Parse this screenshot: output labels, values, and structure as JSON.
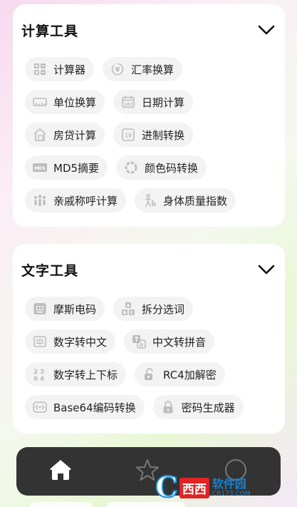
{
  "sections": [
    {
      "title": "计算工具",
      "rows": [
        [
          {
            "label": "计算器",
            "icon": "calculator-icon"
          },
          {
            "label": "汇率换算",
            "icon": "currency-exchange-icon"
          }
        ],
        [
          {
            "label": "单位换算",
            "icon": "ruler-icon"
          },
          {
            "label": "日期计算",
            "icon": "calendar-icon"
          }
        ],
        [
          {
            "label": "房贷计算",
            "icon": "house-loan-icon"
          },
          {
            "label": "进制转换",
            "icon": "number-base-icon"
          }
        ],
        [
          {
            "label": "MD5摘要",
            "icon": "md5-icon"
          },
          {
            "label": "颜色码转换",
            "icon": "color-wheel-icon"
          }
        ],
        [
          {
            "label": "亲戚称呼计算",
            "icon": "family-icon"
          },
          {
            "label": "身体质量指数",
            "icon": "body-mass-icon"
          }
        ]
      ]
    },
    {
      "title": "文字工具",
      "rows": [
        [
          {
            "label": "摩斯电码",
            "icon": "keypad-icon"
          },
          {
            "label": "拆分选词",
            "icon": "split-words-icon"
          }
        ],
        [
          {
            "label": "数字转中文",
            "icon": "number-to-chinese-icon"
          },
          {
            "label": "中文转拼音",
            "icon": "chinese-to-pinyin-icon"
          }
        ],
        [
          {
            "label": "数字转上下标",
            "icon": "superscript-icon"
          },
          {
            "label": "RC4加解密",
            "icon": "unlock-icon"
          }
        ],
        [
          {
            "label": "Base64编码转换",
            "icon": "code-convert-icon"
          },
          {
            "label": "密码生成器",
            "icon": "lock-icon"
          }
        ]
      ]
    }
  ],
  "nav": {
    "items": [
      {
        "name": "home",
        "icon": "home-icon",
        "active": true
      },
      {
        "name": "favorites",
        "icon": "star-icon",
        "active": false
      },
      {
        "name": "more",
        "icon": "circle-icon",
        "active": false
      }
    ]
  },
  "watermark": {
    "logo_text": "C",
    "box_text": "西西",
    "name": "软件园",
    "url": "CR173.COM"
  },
  "colors": {
    "card": "#ffffff",
    "chip": "#f3f3f3",
    "icon": "#b8b8b8",
    "nav": "#333333",
    "watermark_red": "#e02424",
    "watermark_blue": "#1a7fd0"
  }
}
